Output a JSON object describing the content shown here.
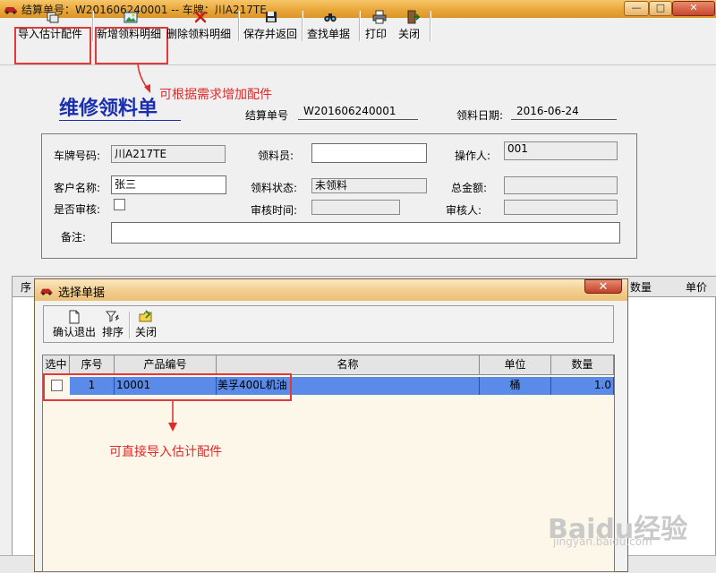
{
  "window": {
    "title": "结算单号：W201606240001 -- 车牌：川A217TE",
    "controls": {
      "minimize": "—",
      "maximize": "□",
      "close": "✕"
    }
  },
  "toolbar": {
    "import_estimate": "导入估计配件",
    "add_detail": "新增领料明细",
    "delete_detail": "删除领料明细",
    "save_return": "保存并返回",
    "find_doc": "查找单据",
    "print": "打印",
    "close": "关闭"
  },
  "annotations": {
    "add_parts": "可根据需求增加配件",
    "direct_import": "可直接导入估计配件"
  },
  "form": {
    "title": "维修领料单",
    "settlement_no_label": "结算单号",
    "settlement_no": "W201606240001",
    "date_label": "领料日期:",
    "date": "2016-06-24",
    "plate_label": "车牌号码:",
    "plate": "川A217TE",
    "picker_label": "领料员:",
    "picker": "",
    "operator_label": "操作人:",
    "operator": "001",
    "customer_label": "客户名称:",
    "customer": "张三",
    "status_label": "领料状态:",
    "status": "未领料",
    "total_label": "总金额:",
    "total": "",
    "audited_label": "是否审核:",
    "audit_time_label": "审核时间:",
    "audit_time": "",
    "auditor_label": "审核人:",
    "auditor": "",
    "remark_label": "备注:",
    "remark": ""
  },
  "main_grid": {
    "headers": [
      "序",
      "数量",
      "单价"
    ]
  },
  "dialog": {
    "title": "选择单据",
    "close": "✕",
    "toolbar": {
      "confirm_exit": "确认退出",
      "sort": "排序",
      "close": "关闭"
    },
    "columns": [
      "选中",
      "序号",
      "产品编号",
      "名称",
      "单位",
      "数量"
    ],
    "rows": [
      {
        "index": "1",
        "code": "10001",
        "name": "美孚400L机油",
        "unit": "桶",
        "qty": "1.0"
      }
    ]
  },
  "watermark": {
    "brand": "Baidu经验",
    "url": "jingyan.baidu.com"
  },
  "colors": {
    "title_bar": "#e9a73a",
    "selection": "#5b8be8",
    "annotation": "#e02a2a",
    "form_title": "#1a2fb0"
  }
}
